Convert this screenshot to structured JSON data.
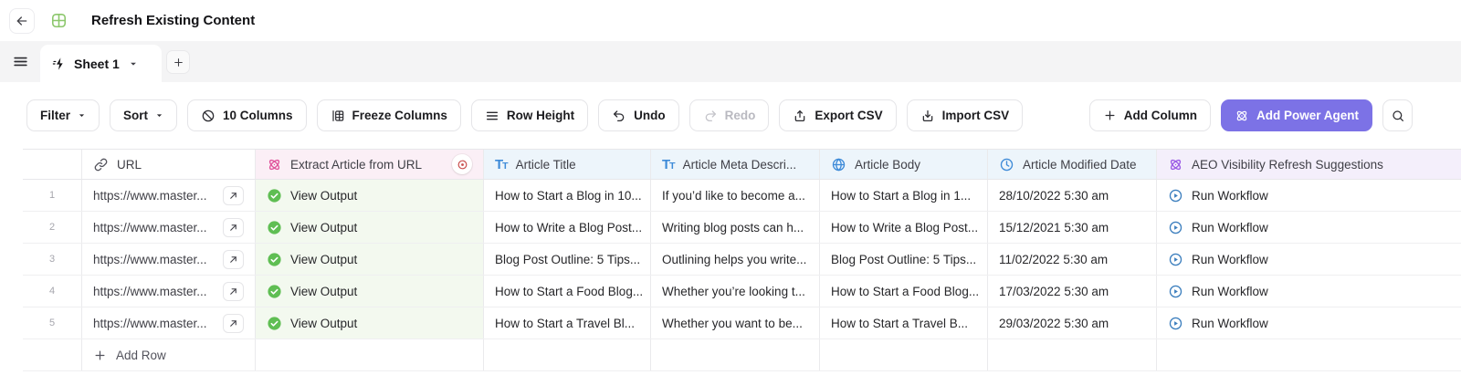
{
  "header": {
    "title": "Refresh Existing Content"
  },
  "tabbar": {
    "active_tab_label": "Sheet 1"
  },
  "toolbar": {
    "filter": "Filter",
    "sort": "Sort",
    "columns": "10 Columns",
    "freeze": "Freeze Columns",
    "row_height": "Row Height",
    "undo": "Undo",
    "redo": "Redo",
    "redo_disabled": true,
    "export_csv": "Export CSV",
    "import_csv": "Import CSV",
    "add_column": "Add Column",
    "add_power_agent": "Add Power Agent"
  },
  "table": {
    "columns": {
      "url": "URL",
      "extract": "Extract Article from URL",
      "title": "Article Title",
      "meta": "Article Meta Descri...",
      "body": "Article Body",
      "modified": "Article Modified Date",
      "aeo": "AEO Visibility Refresh Suggestions"
    },
    "rows": [
      {
        "num": "1",
        "url": "https://www.master...",
        "extract_status": "View Output",
        "title": "How to Start a Blog in 10...",
        "meta": "If you’d like to become a...",
        "body": "How to Start a Blog in 1...",
        "modified": "28/10/2022 5:30 am",
        "aeo_action": "Run Workflow"
      },
      {
        "num": "2",
        "url": "https://www.master...",
        "extract_status": "View Output",
        "title": "How to Write a Blog Post...",
        "meta": "Writing blog posts can h...",
        "body": "How to Write a Blog Post...",
        "modified": "15/12/2021 5:30 am",
        "aeo_action": "Run Workflow"
      },
      {
        "num": "3",
        "url": "https://www.master...",
        "extract_status": "View Output",
        "title": "Blog Post Outline: 5 Tips...",
        "meta": "Outlining helps you write...",
        "body": "Blog Post Outline: 5 Tips...",
        "modified": "11/02/2022 5:30 am",
        "aeo_action": "Run Workflow"
      },
      {
        "num": "4",
        "url": "https://www.master...",
        "extract_status": "View Output",
        "title": "How to Start a Food Blog...",
        "meta": "Whether you’re looking t...",
        "body": "How to Start a Food Blog...",
        "modified": "17/03/2022 5:30 am",
        "aeo_action": "Run Workflow"
      },
      {
        "num": "5",
        "url": "https://www.master...",
        "extract_status": "View Output",
        "title": "How to Start a Travel Bl...",
        "meta": "Whether you want to be...",
        "body": "How to Start a Travel B...",
        "modified": "29/03/2022 5:30 am",
        "aeo_action": "Run Workflow"
      }
    ],
    "add_row_label": "Add Row"
  },
  "icons": {
    "back": "arrow-left",
    "app": "grid-table",
    "menu": "hamburger",
    "sheet_tab": "zap",
    "hide_columns": "slashed-circle",
    "freeze": "freeze-panel",
    "row_height": "rows",
    "undo": "undo-arrow",
    "redo": "redo-arrow",
    "export": "upload-tray",
    "import": "download-tray",
    "add": "plus",
    "power_agent": "atom",
    "search": "magnifier",
    "url_column": "link",
    "extract_column": "atom",
    "text_column": "Tt",
    "body_column": "globe",
    "date_column": "clock",
    "aeo_column": "atom",
    "extract_status": "check-circle",
    "run": "play-circle",
    "open_url": "arrow-up-right",
    "record_badge": "circle-dot"
  },
  "colors": {
    "accent_purple": "#7C72E6",
    "pink_column": "#E0549B",
    "pink_column_bg": "#FBEFF6",
    "blue_column": "#3E8BD8",
    "blue_column_bg": "#EDF5FB",
    "purple_column": "#9C5BE5",
    "purple_column_bg": "#F4EFFB",
    "success_green": "#5FBE53",
    "success_green_bg": "#F3F9EF",
    "run_workflow_blue": "#3D7FBE",
    "tabbar_bg": "#F4F4F5"
  }
}
